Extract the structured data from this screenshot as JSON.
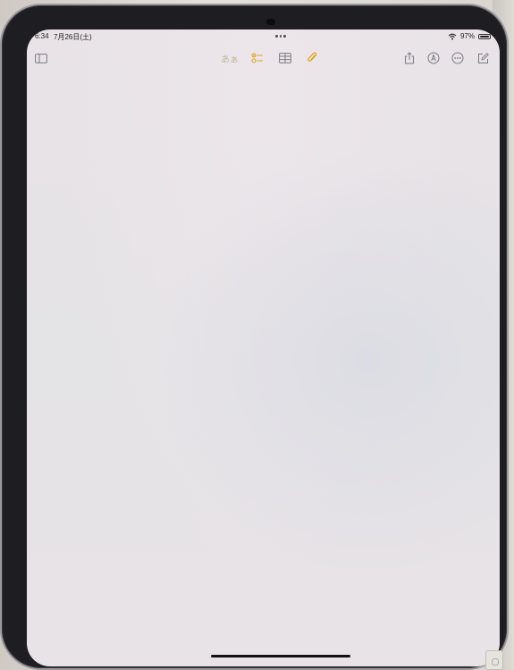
{
  "status_bar": {
    "time": "6:34",
    "date": "7月26日(土)",
    "battery_percent": "97%",
    "battery_level": 0.97
  },
  "toolbar": {
    "sidebar_icon": "sidebar-icon",
    "text_format_label": "あぁ",
    "checklist_icon": "checklist-icon",
    "table_icon": "table-icon",
    "attachment_icon": "paperclip-icon",
    "share_icon": "share-icon",
    "markup_icon": "markup-pen-icon",
    "more_icon": "ellipsis-circle-icon",
    "compose_icon": "compose-icon"
  },
  "colors": {
    "accent": "#e0a21c",
    "screen_bg": "#e8e3e7",
    "bezel": "#1e1d22",
    "icon_gray": "#6b6b70"
  }
}
